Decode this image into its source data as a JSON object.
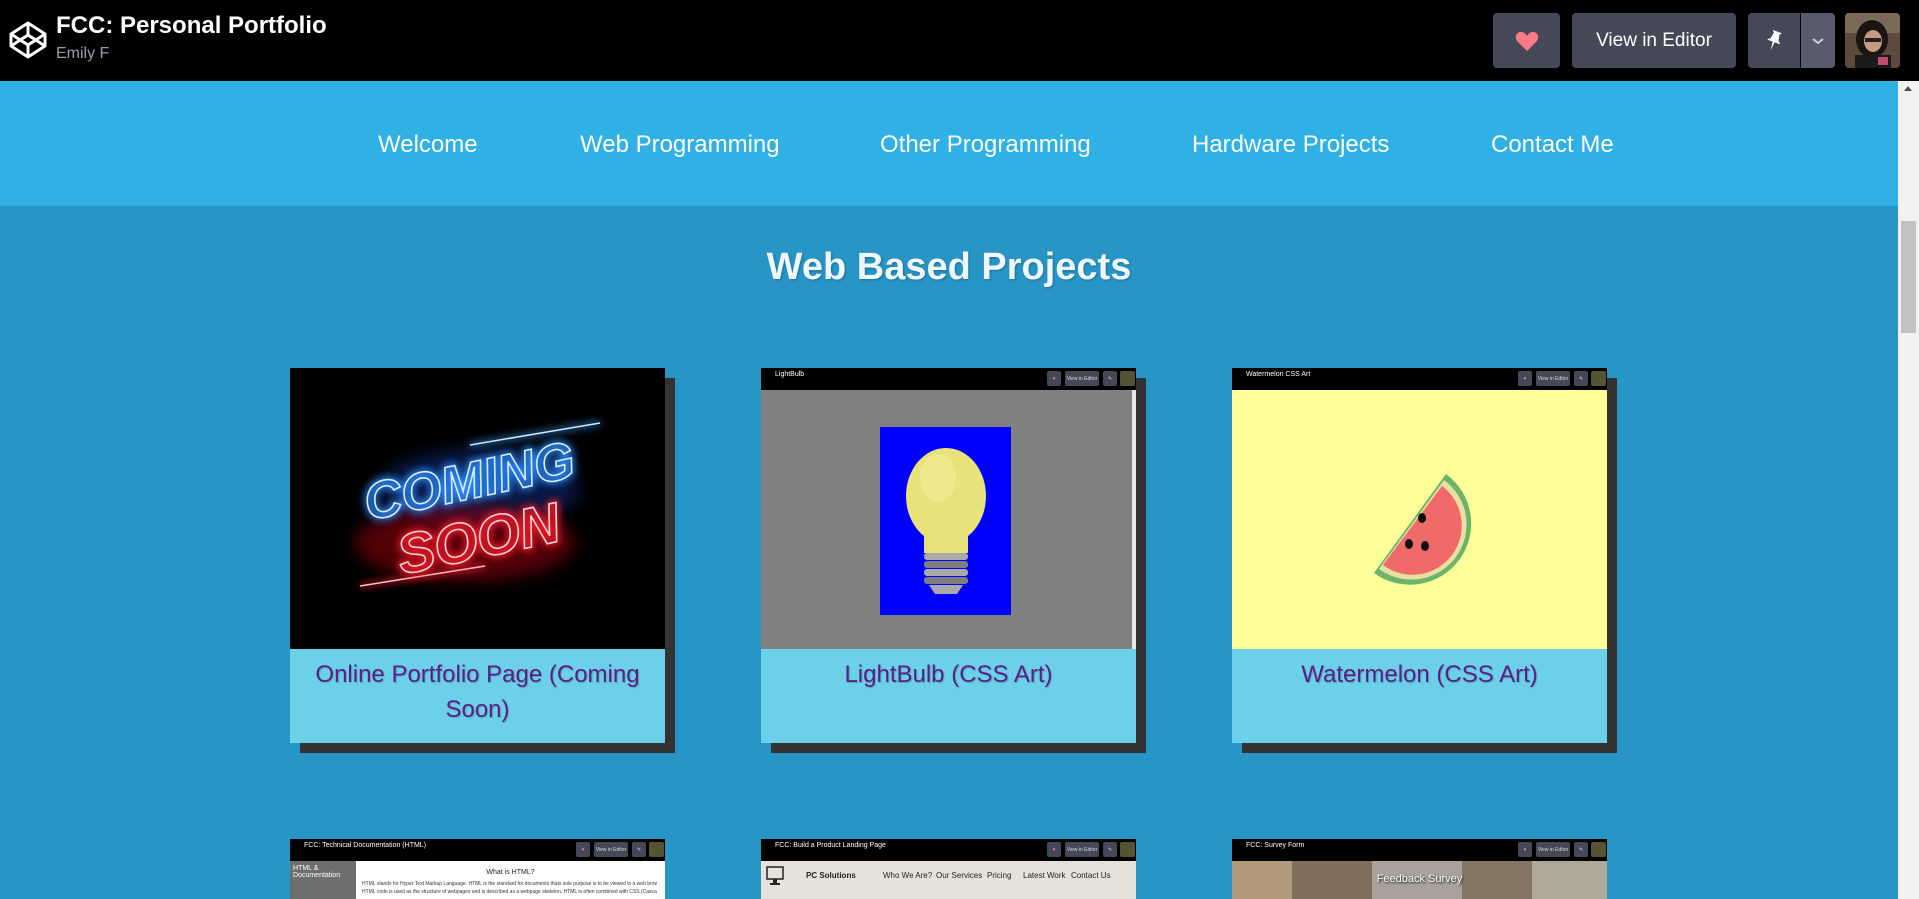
{
  "topbar": {
    "pen_title": "FCC: Personal Portfolio",
    "author": "Emily F",
    "view_in_editor": "View in Editor",
    "icons": [
      "codepen-logo-icon",
      "heart-icon",
      "pin-icon",
      "chevron-down-icon"
    ]
  },
  "nav": {
    "items": [
      "Welcome",
      "Web Programming",
      "Other Programming",
      "Hardware Projects",
      "Contact Me"
    ]
  },
  "section": {
    "title": "Web Based Projects"
  },
  "projects": [
    {
      "caption": "Online Portfolio Page (Coming Soon)",
      "thumb_text": [
        "COMING",
        "SOON"
      ]
    },
    {
      "caption": "LightBulb (CSS Art)",
      "thumb_title": "LightBulb",
      "thumb_button": "View in Editor"
    },
    {
      "caption": "Watermelon (CSS Art)",
      "thumb_title": "Watermelon CSS Art",
      "thumb_button": "View in Editor"
    }
  ],
  "projects_row2": [
    {
      "thumb_title": "FCC: Technical Documentation (HTML)",
      "sidebar": "HTML & Documentation",
      "heading": "What is HTML?",
      "body": [
        "HTML stands for Hyper Text Markup Language. HTML is the standard for documents thats sole purpose is to be viewed in a web browser.",
        "HTML code is used as the structure of webpages and is described as a webpage skeleton. HTML is often combined with CSS (Cascading Style"
      ]
    },
    {
      "thumb_title": "FCC: Build a Product Landing Page",
      "brand": "PC Solutions",
      "links": [
        "Who We Are?",
        "Our Services",
        "Pricing",
        "Latest Work",
        "Contact Us"
      ]
    },
    {
      "thumb_title": "FCC: Survey Form",
      "banner": "Feedback Survey"
    }
  ],
  "colors": {
    "topbar": "#000000",
    "navbar": "#2fb1e6",
    "page_bg": "#2795c5",
    "caption_bg": "#6cd0e8",
    "caption_text": "#5b1f84",
    "heart": "#ff7a86"
  }
}
